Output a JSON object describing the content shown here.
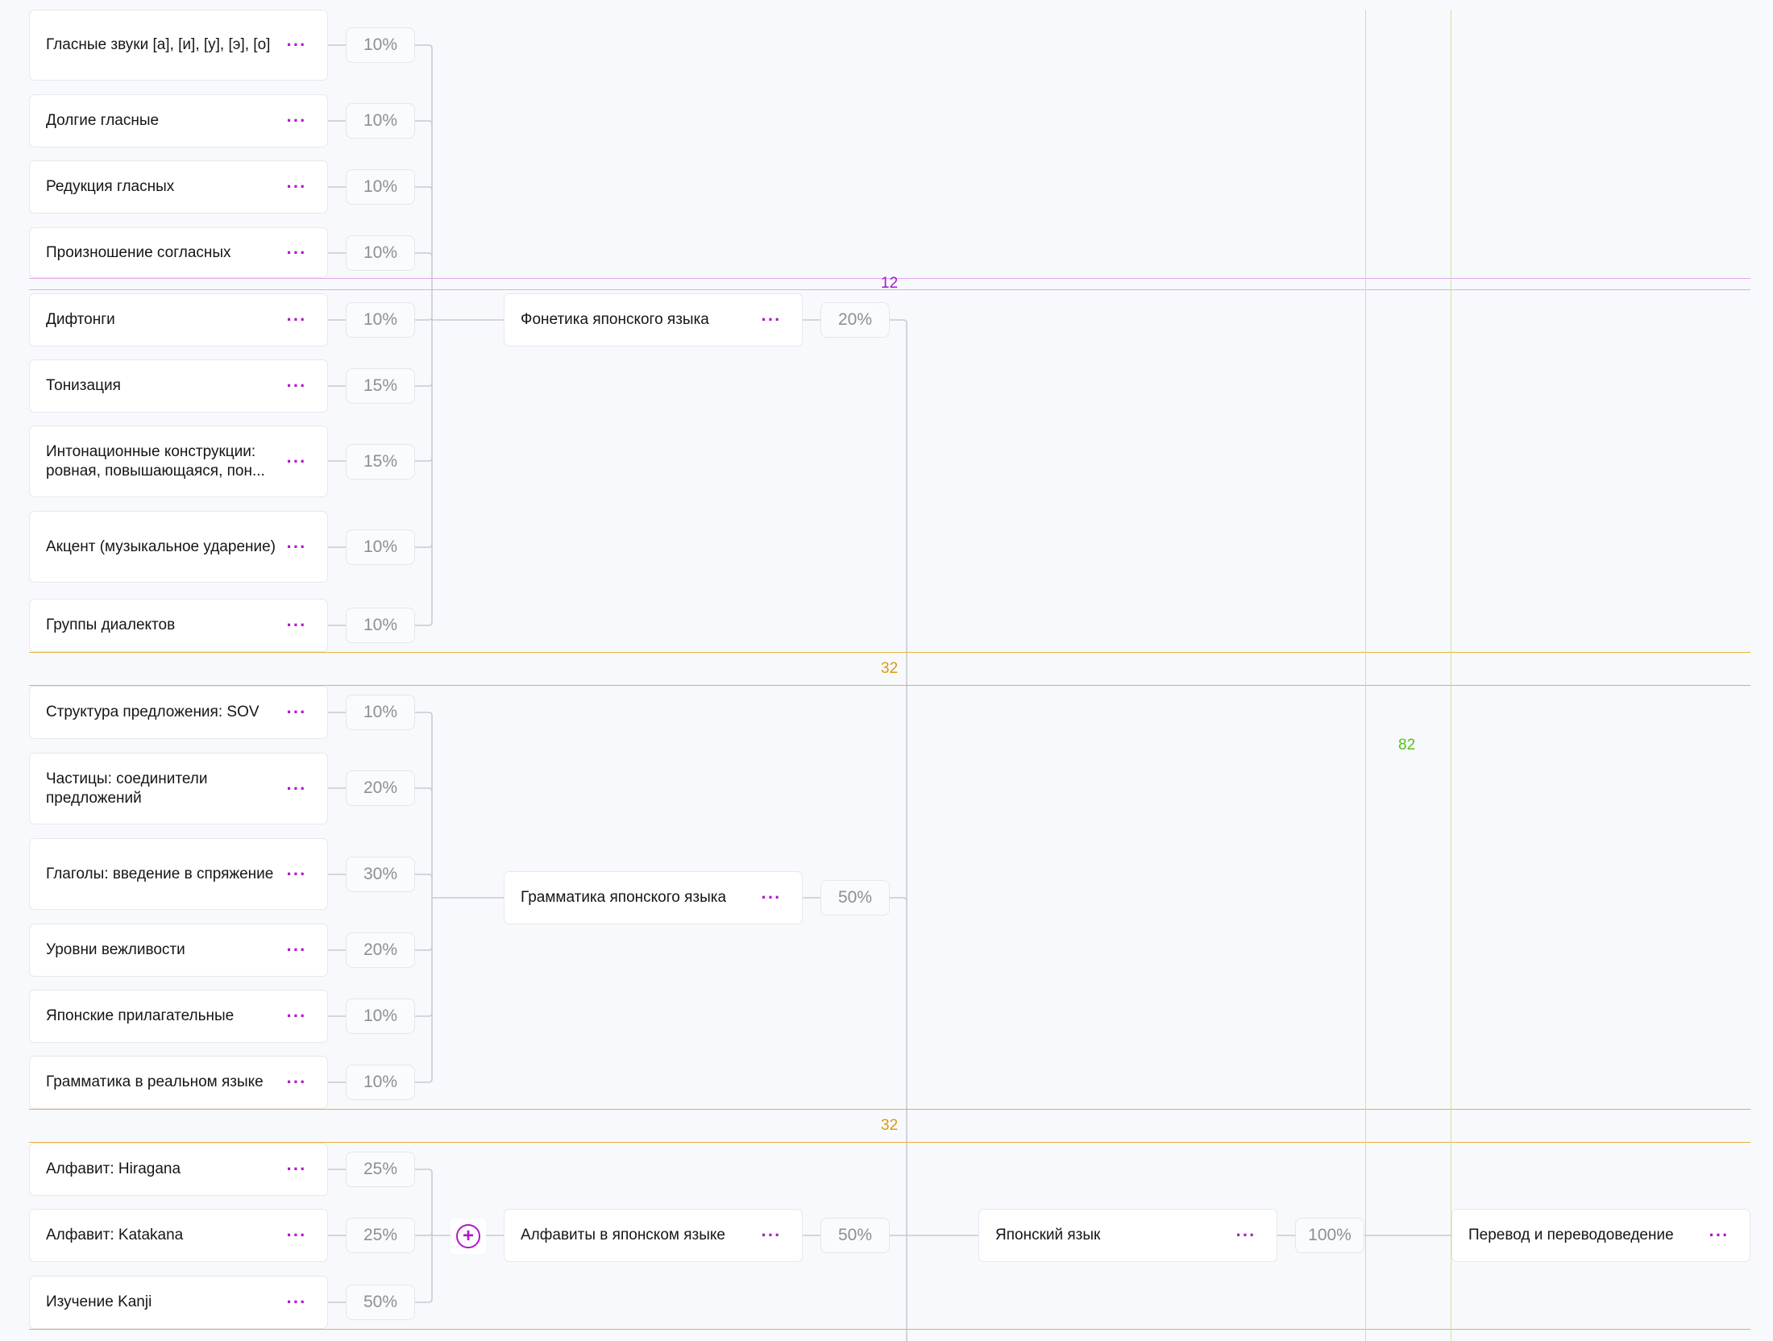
{
  "leaves": [
    {
      "id": "l1",
      "label": "Гласные звуки [а], [и], [у], [э], [о]",
      "pct": "10%"
    },
    {
      "id": "l2",
      "label": "Долгие гласные",
      "pct": "10%"
    },
    {
      "id": "l3",
      "label": "Редукция гласных",
      "pct": "10%"
    },
    {
      "id": "l4",
      "label": "Произношение согласных",
      "pct": "10%"
    },
    {
      "id": "l5",
      "label": "Дифтонги",
      "pct": "10%"
    },
    {
      "id": "l6",
      "label": "Тонизация",
      "pct": "15%"
    },
    {
      "id": "l7",
      "label": "Интонационные конструкции: ровная, повышающаяся, пон...",
      "pct": "15%"
    },
    {
      "id": "l8",
      "label": "Акцент (музыкальное ударение)",
      "pct": "10%"
    },
    {
      "id": "l9",
      "label": "Группы диалектов",
      "pct": "10%"
    },
    {
      "id": "l10",
      "label": "Структура предложения: SOV",
      "pct": "10%"
    },
    {
      "id": "l11",
      "label": "Частицы: соединители предложений",
      "pct": "20%"
    },
    {
      "id": "l12",
      "label": "Глаголы: введение в спряжение",
      "pct": "30%"
    },
    {
      "id": "l13",
      "label": "Уровни вежливости",
      "pct": "20%"
    },
    {
      "id": "l14",
      "label": "Японские прилагательные",
      "pct": "10%"
    },
    {
      "id": "l15",
      "label": "Грамматика в реальном языке",
      "pct": "10%"
    },
    {
      "id": "l16",
      "label": "Алфавит: Hiragana",
      "pct": "25%"
    },
    {
      "id": "l17",
      "label": "Алфавит: Katakana",
      "pct": "25%"
    },
    {
      "id": "l18",
      "label": "Изучение Kanji",
      "pct": "50%"
    }
  ],
  "groups": [
    {
      "id": "g1",
      "label": "Фонетика японского языка",
      "pct": "20%"
    },
    {
      "id": "g2",
      "label": "Грамматика японского языка",
      "pct": "50%"
    },
    {
      "id": "g3",
      "label": "Алфавиты в японском языке",
      "pct": "50%"
    }
  ],
  "subject": {
    "label": "Японский язык",
    "pct": "100%"
  },
  "root": {
    "label": "Перевод и переводоведение"
  },
  "spacing": {
    "top": "12",
    "middle1": "32",
    "middle2": "32",
    "vertical": "82"
  },
  "icons": {
    "more": "more-horizontal-icon",
    "add": "add-circle-icon"
  },
  "colors": {
    "accent": "#b019c8",
    "guide_purple": "#e2a8ef",
    "guide_orange": "#e7b23a",
    "guide_green": "#b7eca0"
  }
}
